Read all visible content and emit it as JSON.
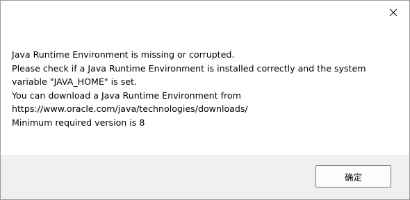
{
  "dialog": {
    "close_icon": "close-icon",
    "message_lines": [
      "Java Runtime Environment is missing or corrupted.",
      "Please check if a Java Runtime Environment is installed correctly and the system",
      "variable \"JAVA_HOME\" is set.",
      "You can download a Java Runtime Environment from",
      "https://www.oracle.com/java/technologies/downloads/",
      "Minimum required version is 8"
    ],
    "ok_label": "确定"
  },
  "colors": {
    "footer_bg": "#f0f0f0",
    "button_border": "#707070"
  }
}
